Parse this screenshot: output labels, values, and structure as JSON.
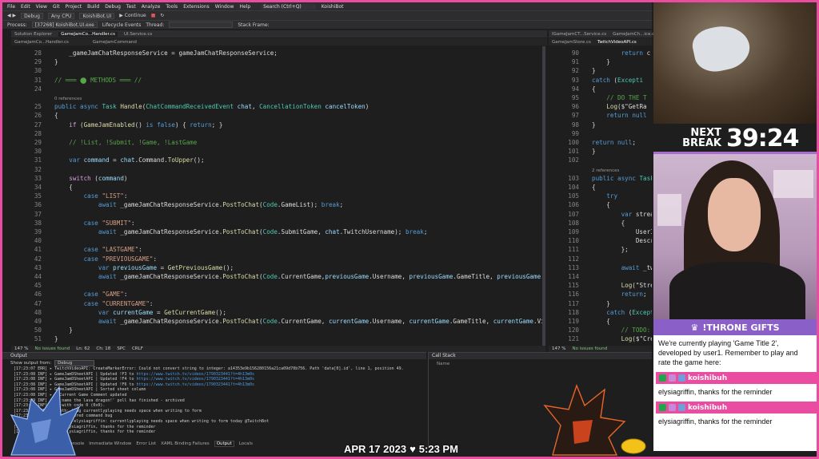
{
  "menu": [
    "File",
    "Edit",
    "View",
    "Git",
    "Project",
    "Build",
    "Debug",
    "Test",
    "Analyze",
    "Tools",
    "Extensions",
    "Window",
    "Help",
    "Search (Ctrl+Q)",
    "KoishiBot"
  ],
  "toolbar": {
    "config": "Debug",
    "platform": "Any CPU",
    "startup": "KoishiBot.UI",
    "continue": "Continue"
  },
  "procbar": {
    "process_label": "Process:",
    "process": "[37268] KoishiBot.UI.exe",
    "lifecycle": "Lifecycle Events",
    "thread": "Thread:",
    "stackframe": "Stack Frame:"
  },
  "left_tabs": [
    "Solution Explorer",
    "GameJamCo...Handler.cs",
    "UI.Service.cs"
  ],
  "right_tabs": [
    "IGameJamCT...Service.cs",
    "GameJamCh...ice.cs",
    "TwitchVideoAPI.cs"
  ],
  "left_path": [
    "GameJamCo...Handler.cs",
    "GameJamCommand"
  ],
  "right_path": [
    "GameJamStore.cs",
    "TwitchVideoAPI.cs"
  ],
  "left_editor": {
    "lines": [
      {
        "n": "28",
        "t": "    _gameJamChatResponseService = gameJamChatResponseService;"
      },
      {
        "n": "29",
        "t": "}"
      },
      {
        "n": "30",
        "t": ""
      },
      {
        "n": "31",
        "t": "// ═══ ⬤ METHODS ═══ //"
      },
      {
        "n": "24",
        "t": ""
      },
      {
        "n": "",
        "t": "0 references"
      },
      {
        "n": "25",
        "t": "public async Task Handle(ChatCommandReceivedEvent chat, CancellationToken cancelToken)"
      },
      {
        "n": "26",
        "t": "{"
      },
      {
        "n": "27",
        "t": "    if (GameJamEnabled() is false) { return; }"
      },
      {
        "n": "28",
        "t": ""
      },
      {
        "n": "29",
        "t": "    // !List, !Submit, !Game, !LastGame"
      },
      {
        "n": "30",
        "t": ""
      },
      {
        "n": "31",
        "t": "    var command = chat.Command.ToUpper();"
      },
      {
        "n": "32",
        "t": ""
      },
      {
        "n": "33",
        "t": "    switch (command)"
      },
      {
        "n": "34",
        "t": "    {"
      },
      {
        "n": "35",
        "t": "        case \"LIST\":"
      },
      {
        "n": "36",
        "t": "            await _gameJamChatResponseService.PostToChat(Code.GameList); break;"
      },
      {
        "n": "37",
        "t": ""
      },
      {
        "n": "38",
        "t": "        case \"SUBMIT\":"
      },
      {
        "n": "39",
        "t": "            await _gameJamChatResponseService.PostToChat(Code.SubmitGame, chat.TwitchUsername); break;"
      },
      {
        "n": "40",
        "t": ""
      },
      {
        "n": "41",
        "t": "        case \"LASTGAME\":"
      },
      {
        "n": "42",
        "t": "        case \"PREVIOUSGAME\":"
      },
      {
        "n": "43",
        "t": "            var previousGame = GetPreviousGame();"
      },
      {
        "n": "44",
        "t": "            await _gameJamChatResponseService.PostToChat(Code.CurrentGame,previousGame.Username, previousGame.GameTitle, previousGame.Vi"
      },
      {
        "n": "45",
        "t": ""
      },
      {
        "n": "46",
        "t": "        case \"GAME\":"
      },
      {
        "n": "47",
        "t": "        case \"CURRENTGAME\":"
      },
      {
        "n": "48",
        "t": "            var currentGame = GetCurrentGame();"
      },
      {
        "n": "49",
        "t": "            await _gameJamChatResponseService.PostToChat(Code.CurrentGame, currentGame.Username, currentGame.GameTitle, currentGame.Vide"
      },
      {
        "n": "50",
        "t": "    }"
      },
      {
        "n": "51",
        "t": "}"
      }
    ],
    "status": [
      "147 %",
      "No issues found",
      "Ln: 62",
      "Ch: 18",
      "SPC",
      "CRLF"
    ]
  },
  "right_editor": {
    "lines": [
      {
        "n": "90",
        "t": "        return c"
      },
      {
        "n": "91",
        "t": "    }"
      },
      {
        "n": "92",
        "t": "}"
      },
      {
        "n": "93",
        "t": "catch (Excepti"
      },
      {
        "n": "94",
        "t": "{"
      },
      {
        "n": "95",
        "t": "    // DO THE T"
      },
      {
        "n": "96",
        "t": "    Log($\"GetRa"
      },
      {
        "n": "97",
        "t": "    return null"
      },
      {
        "n": "98",
        "t": "}"
      },
      {
        "n": "99",
        "t": ""
      },
      {
        "n": "100",
        "t": "return null;"
      },
      {
        "n": "101",
        "t": "}"
      },
      {
        "n": "102",
        "t": ""
      },
      {
        "n": "",
        "t": "2 references"
      },
      {
        "n": "103",
        "t": "public async Task"
      },
      {
        "n": "104",
        "t": "{"
      },
      {
        "n": "105",
        "t": "    try"
      },
      {
        "n": "106",
        "t": "    {"
      },
      {
        "n": "107",
        "t": "        var streamM"
      },
      {
        "n": "108",
        "t": "        {"
      },
      {
        "n": "109",
        "t": "            UserId ="
      },
      {
        "n": "110",
        "t": "            Descript"
      },
      {
        "n": "111",
        "t": "        };"
      },
      {
        "n": "112",
        "t": ""
      },
      {
        "n": "113",
        "t": "        await _twit"
      },
      {
        "n": "114",
        "t": ""
      },
      {
        "n": "115",
        "t": "        Log(\"Stream"
      },
      {
        "n": "116",
        "t": "        return;"
      },
      {
        "n": "117",
        "t": "    }"
      },
      {
        "n": "118",
        "t": "    catch (Excepti"
      },
      {
        "n": "119",
        "t": "    {"
      },
      {
        "n": "120",
        "t": "        // TODO: Th"
      },
      {
        "n": "121",
        "t": "        Log($\"Creat"
      }
    ],
    "status": [
      "147 %",
      "No issues found"
    ]
  },
  "output": {
    "title": "Output",
    "show_from_label": "Show output from:",
    "show_from": "Debug",
    "lines": [
      "[17:23:07 ERR] ▸ TwitchVideoAPI: CreateMarkerError: Could not convert string to integer: a14353e9b156280156a21ca09d70b756. Path 'data[0].id', line 1, position 49.",
      "[17:23:08 INF] ▸ GameJamDSheetAPI | Updated !F3 to https://www.twitch.tv/videos/1790323441?t=4h13m0s",
      "[17:23:08 INF] ▸ GameJamDSheetAPI | Updated !F4 to https://www.twitch.tv/videos/1790323441?t=4h13m0s",
      "[17:23:08 INF] ▸ GameJamDSheetAPI | Updated !F6 to https://www.twitch.tv/videos/1790323441?t=4h13m0s",
      "[17:23:08 INF] ▸ GameJamDSheetAPI | Sorted sheet column",
      "[17:23:08 INF] ▸ | Current Game Comment updated",
      "[17:23:09 INF] ▸ we name the lava dragon!' poll has finished - archived",
      "[17:23:09 INF] ▸ ed with code 0 (0x0).",
      "[17:23:09 INF] ▸ smuth: !bug currentlyplaying needs space when writing to form",
      "[17:23:09 INF] ▸ on triggered command bug",
      "[17:23:10 INF] ▸ usit: @ elysiagriffin: currentlyplaying needs space when writing to form today @TwitchBot",
      "[17:23:10 INF] ▸ in: elysiagriffin, thanks for the reminder",
      "[17:23:10 INF] ▸ in: elysiagriffin, thanks for the reminder"
    ]
  },
  "bottom_tabs": [
    "Package Manager Console",
    "Immediate Window",
    "Error List",
    "XAML Binding Failures",
    "Output",
    "Locals"
  ],
  "callstack": {
    "title": "Call Stack",
    "col": "Name"
  },
  "overlay": {
    "next_break_1": "NEXT",
    "next_break_2": "BREAK",
    "countdown": "39:24",
    "throne_label": "!THRONE GIFTS",
    "info_msg": "We're currently playing 'Game Title 2', developed by user1. Remember to play and rate the game here:",
    "chat": [
      {
        "user": "koishibuh",
        "msg": "elysiagriffin, thanks for the reminder"
      },
      {
        "user": "koishibuh",
        "msg": "elysiagriffin, thanks for the reminder"
      }
    ],
    "date": "APR 17 2023",
    "heart": "♥",
    "time": "5:23 PM"
  },
  "colors": {
    "accent": "#e94ca0",
    "throne": "#8a5fc7",
    "editor_bg": "#1e1e1e"
  }
}
